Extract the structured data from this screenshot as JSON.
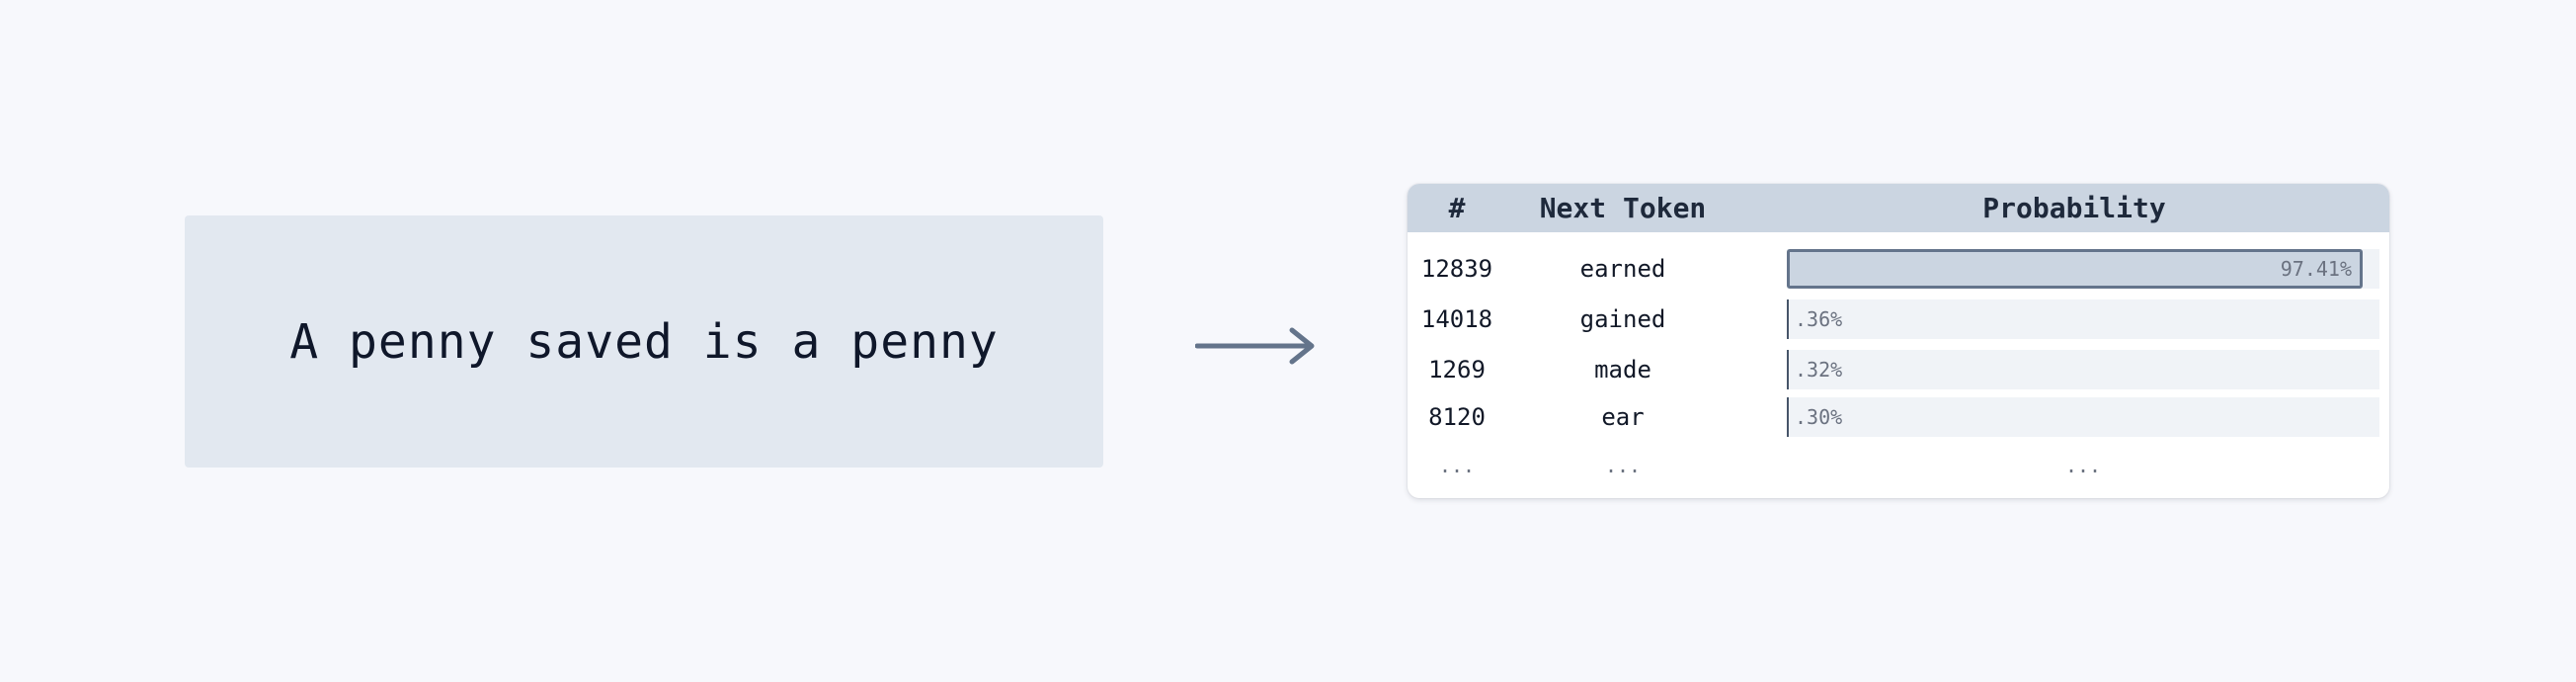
{
  "prompt": {
    "text": "A penny saved is a penny"
  },
  "table": {
    "headers": {
      "rank": "#",
      "token": "Next Token",
      "probability": "Probability"
    },
    "rows": [
      {
        "rank": "12839",
        "token": "earned",
        "prob_label": "97.41%",
        "prob": 0.9741
      },
      {
        "rank": "14018",
        "token": "gained",
        "prob_label": ".36%",
        "prob": 0.0036
      },
      {
        "rank": "1269",
        "token": "made",
        "prob_label": ".32%",
        "prob": 0.0032
      },
      {
        "rank": "8120",
        "token": "ear",
        "prob_label": ".30%",
        "prob": 0.003
      }
    ],
    "ellipsis": {
      "rank": "...",
      "token": "...",
      "probability": "..."
    }
  },
  "colors": {
    "accent_bar": "#cbd5e1",
    "bar_border": "#64748b",
    "arrow": "#64748b"
  },
  "icons": {
    "arrow": "right-arrow-icon"
  }
}
